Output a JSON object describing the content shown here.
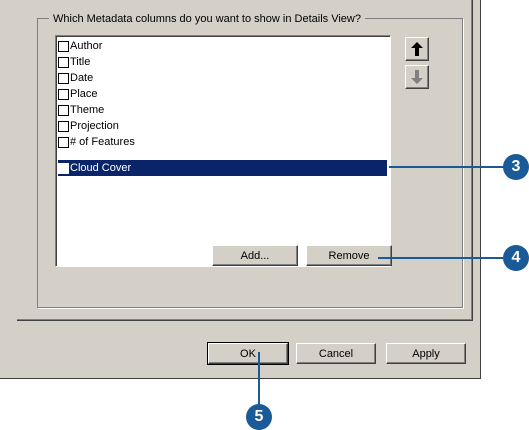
{
  "group": {
    "label": "Which Metadata columns do you want to show in Details View?"
  },
  "list": {
    "items": [
      {
        "label": "Author",
        "checked": false,
        "selected": false
      },
      {
        "label": "Title",
        "checked": false,
        "selected": false
      },
      {
        "label": "Date",
        "checked": false,
        "selected": false
      },
      {
        "label": "Place",
        "checked": false,
        "selected": false
      },
      {
        "label": "Theme",
        "checked": false,
        "selected": false
      },
      {
        "label": "Projection",
        "checked": false,
        "selected": false
      },
      {
        "label": "# of Features",
        "checked": false,
        "selected": false
      },
      {
        "label": "Cloud Cover",
        "checked": false,
        "selected": true
      }
    ]
  },
  "actions": {
    "add_label": "Add...",
    "remove_label": "Remove"
  },
  "footer": {
    "ok_label": "OK",
    "cancel_label": "Cancel",
    "apply_label": "Apply"
  },
  "callouts": {
    "c3": "3",
    "c4": "4",
    "c5": "5"
  },
  "colors": {
    "dialog_bg": "#d4d0c8",
    "selection": "#0a246a",
    "callout": "#1a5a96"
  },
  "icons": {
    "move_up": "arrow-up-icon",
    "move_down": "arrow-down-icon"
  }
}
